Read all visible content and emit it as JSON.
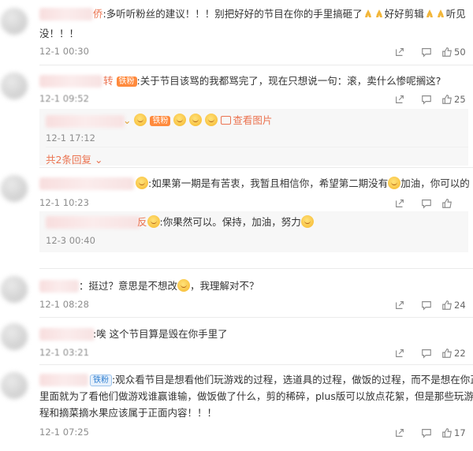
{
  "comments": [
    {
      "name_tail": "侨",
      "text_line1": ":多听听粉丝的建议！！！别把好好的节目在你的手里搞砸了",
      "text_line1b": "好好剪辑",
      "text_line1c": "听见",
      "text_line2": "没！！！",
      "time": "12-1 00:30",
      "likes": "50"
    },
    {
      "name_tail": "转",
      "badge": "铁粉",
      "text": ":关于节目该骂的我都骂完了，现在只想说一句：滚，卖什么惨呢搁这?",
      "time": "12-1 09:52",
      "likes": "25",
      "replies": [
        {
          "badge": "铁粉",
          "pic_link": "查看图片",
          "time": "12-1 17:12"
        }
      ],
      "more_replies": "共2条回复"
    },
    {
      "text_a": ":如果第一期是有苦衷，我暂且相信你，希望第二期没有",
      "text_b": "加油，你可以的",
      "time": "12-1 10:23",
      "likes": "",
      "replies": [
        {
          "name_tail": "反",
          "text": ":你果然可以。保持，加油，努力",
          "time": "12-3 00:40"
        }
      ]
    },
    {
      "text_a": "：挺过？意思是不想改",
      "text_b": "，我理解对不？",
      "time": "12-1 08:28",
      "likes": "24"
    },
    {
      "text": ":唉 这个节目算是毁在你手里了",
      "time": "12-1 03:21",
      "likes": "22"
    },
    {
      "badge": "铁粉",
      "text_line1": ":观众看节目是想看他们玩游戏的过程，选道具的过程，做饭的过程，而不是想在你正片",
      "text_line2": "里面就为了看他们做游戏谁赢谁输，做饭做了什么，剪的稀碎，plus版可以放点花絮，但是那些玩游戏过",
      "text_line3": "程和摘菜摘水果应该属于正面内容！！！",
      "time": "12-1 07:25",
      "likes": "17"
    }
  ]
}
